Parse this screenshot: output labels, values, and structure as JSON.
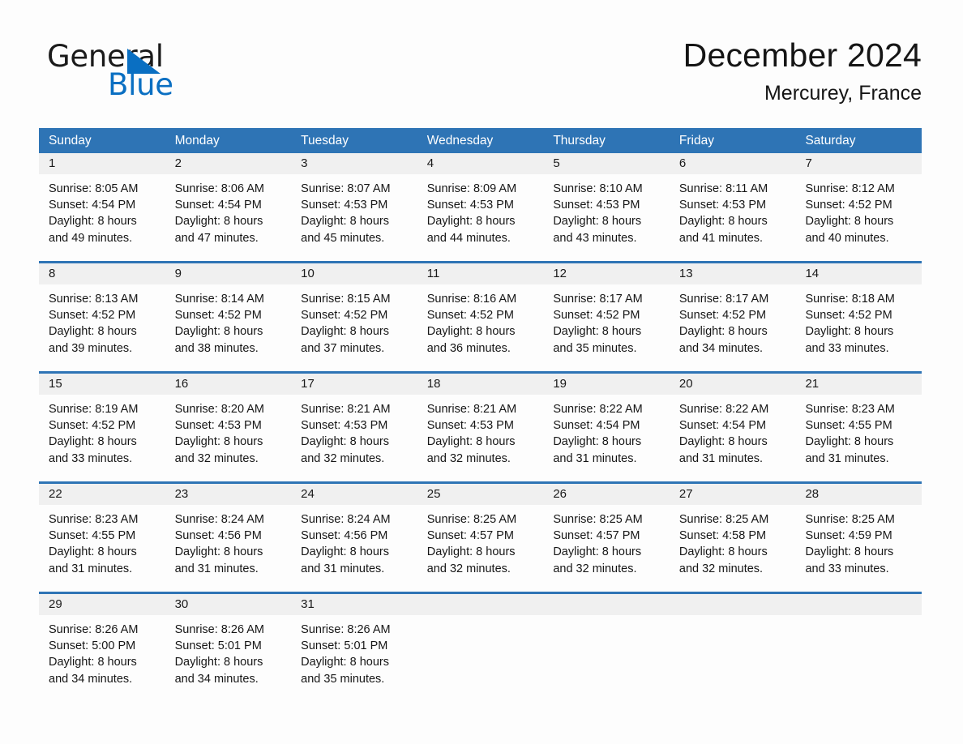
{
  "brand": {
    "name_part1": "General",
    "name_part2": "Blue",
    "logo_icon": "triangle-logo-icon"
  },
  "header": {
    "title": "December 2024",
    "location": "Mercurey, France"
  },
  "calendar": {
    "weekdays": [
      "Sunday",
      "Monday",
      "Tuesday",
      "Wednesday",
      "Thursday",
      "Friday",
      "Saturday"
    ],
    "accent_color": "#2e74b5",
    "day_band_color": "#f0f0f0",
    "weeks": [
      [
        {
          "day": "1",
          "sunrise": "Sunrise: 8:05 AM",
          "sunset": "Sunset: 4:54 PM",
          "daylight_line1": "Daylight: 8 hours",
          "daylight_line2": "and 49 minutes."
        },
        {
          "day": "2",
          "sunrise": "Sunrise: 8:06 AM",
          "sunset": "Sunset: 4:54 PM",
          "daylight_line1": "Daylight: 8 hours",
          "daylight_line2": "and 47 minutes."
        },
        {
          "day": "3",
          "sunrise": "Sunrise: 8:07 AM",
          "sunset": "Sunset: 4:53 PM",
          "daylight_line1": "Daylight: 8 hours",
          "daylight_line2": "and 45 minutes."
        },
        {
          "day": "4",
          "sunrise": "Sunrise: 8:09 AM",
          "sunset": "Sunset: 4:53 PM",
          "daylight_line1": "Daylight: 8 hours",
          "daylight_line2": "and 44 minutes."
        },
        {
          "day": "5",
          "sunrise": "Sunrise: 8:10 AM",
          "sunset": "Sunset: 4:53 PM",
          "daylight_line1": "Daylight: 8 hours",
          "daylight_line2": "and 43 minutes."
        },
        {
          "day": "6",
          "sunrise": "Sunrise: 8:11 AM",
          "sunset": "Sunset: 4:53 PM",
          "daylight_line1": "Daylight: 8 hours",
          "daylight_line2": "and 41 minutes."
        },
        {
          "day": "7",
          "sunrise": "Sunrise: 8:12 AM",
          "sunset": "Sunset: 4:52 PM",
          "daylight_line1": "Daylight: 8 hours",
          "daylight_line2": "and 40 minutes."
        }
      ],
      [
        {
          "day": "8",
          "sunrise": "Sunrise: 8:13 AM",
          "sunset": "Sunset: 4:52 PM",
          "daylight_line1": "Daylight: 8 hours",
          "daylight_line2": "and 39 minutes."
        },
        {
          "day": "9",
          "sunrise": "Sunrise: 8:14 AM",
          "sunset": "Sunset: 4:52 PM",
          "daylight_line1": "Daylight: 8 hours",
          "daylight_line2": "and 38 minutes."
        },
        {
          "day": "10",
          "sunrise": "Sunrise: 8:15 AM",
          "sunset": "Sunset: 4:52 PM",
          "daylight_line1": "Daylight: 8 hours",
          "daylight_line2": "and 37 minutes."
        },
        {
          "day": "11",
          "sunrise": "Sunrise: 8:16 AM",
          "sunset": "Sunset: 4:52 PM",
          "daylight_line1": "Daylight: 8 hours",
          "daylight_line2": "and 36 minutes."
        },
        {
          "day": "12",
          "sunrise": "Sunrise: 8:17 AM",
          "sunset": "Sunset: 4:52 PM",
          "daylight_line1": "Daylight: 8 hours",
          "daylight_line2": "and 35 minutes."
        },
        {
          "day": "13",
          "sunrise": "Sunrise: 8:17 AM",
          "sunset": "Sunset: 4:52 PM",
          "daylight_line1": "Daylight: 8 hours",
          "daylight_line2": "and 34 minutes."
        },
        {
          "day": "14",
          "sunrise": "Sunrise: 8:18 AM",
          "sunset": "Sunset: 4:52 PM",
          "daylight_line1": "Daylight: 8 hours",
          "daylight_line2": "and 33 minutes."
        }
      ],
      [
        {
          "day": "15",
          "sunrise": "Sunrise: 8:19 AM",
          "sunset": "Sunset: 4:52 PM",
          "daylight_line1": "Daylight: 8 hours",
          "daylight_line2": "and 33 minutes."
        },
        {
          "day": "16",
          "sunrise": "Sunrise: 8:20 AM",
          "sunset": "Sunset: 4:53 PM",
          "daylight_line1": "Daylight: 8 hours",
          "daylight_line2": "and 32 minutes."
        },
        {
          "day": "17",
          "sunrise": "Sunrise: 8:21 AM",
          "sunset": "Sunset: 4:53 PM",
          "daylight_line1": "Daylight: 8 hours",
          "daylight_line2": "and 32 minutes."
        },
        {
          "day": "18",
          "sunrise": "Sunrise: 8:21 AM",
          "sunset": "Sunset: 4:53 PM",
          "daylight_line1": "Daylight: 8 hours",
          "daylight_line2": "and 32 minutes."
        },
        {
          "day": "19",
          "sunrise": "Sunrise: 8:22 AM",
          "sunset": "Sunset: 4:54 PM",
          "daylight_line1": "Daylight: 8 hours",
          "daylight_line2": "and 31 minutes."
        },
        {
          "day": "20",
          "sunrise": "Sunrise: 8:22 AM",
          "sunset": "Sunset: 4:54 PM",
          "daylight_line1": "Daylight: 8 hours",
          "daylight_line2": "and 31 minutes."
        },
        {
          "day": "21",
          "sunrise": "Sunrise: 8:23 AM",
          "sunset": "Sunset: 4:55 PM",
          "daylight_line1": "Daylight: 8 hours",
          "daylight_line2": "and 31 minutes."
        }
      ],
      [
        {
          "day": "22",
          "sunrise": "Sunrise: 8:23 AM",
          "sunset": "Sunset: 4:55 PM",
          "daylight_line1": "Daylight: 8 hours",
          "daylight_line2": "and 31 minutes."
        },
        {
          "day": "23",
          "sunrise": "Sunrise: 8:24 AM",
          "sunset": "Sunset: 4:56 PM",
          "daylight_line1": "Daylight: 8 hours",
          "daylight_line2": "and 31 minutes."
        },
        {
          "day": "24",
          "sunrise": "Sunrise: 8:24 AM",
          "sunset": "Sunset: 4:56 PM",
          "daylight_line1": "Daylight: 8 hours",
          "daylight_line2": "and 31 minutes."
        },
        {
          "day": "25",
          "sunrise": "Sunrise: 8:25 AM",
          "sunset": "Sunset: 4:57 PM",
          "daylight_line1": "Daylight: 8 hours",
          "daylight_line2": "and 32 minutes."
        },
        {
          "day": "26",
          "sunrise": "Sunrise: 8:25 AM",
          "sunset": "Sunset: 4:57 PM",
          "daylight_line1": "Daylight: 8 hours",
          "daylight_line2": "and 32 minutes."
        },
        {
          "day": "27",
          "sunrise": "Sunrise: 8:25 AM",
          "sunset": "Sunset: 4:58 PM",
          "daylight_line1": "Daylight: 8 hours",
          "daylight_line2": "and 32 minutes."
        },
        {
          "day": "28",
          "sunrise": "Sunrise: 8:25 AM",
          "sunset": "Sunset: 4:59 PM",
          "daylight_line1": "Daylight: 8 hours",
          "daylight_line2": "and 33 minutes."
        }
      ],
      [
        {
          "day": "29",
          "sunrise": "Sunrise: 8:26 AM",
          "sunset": "Sunset: 5:00 PM",
          "daylight_line1": "Daylight: 8 hours",
          "daylight_line2": "and 34 minutes."
        },
        {
          "day": "30",
          "sunrise": "Sunrise: 8:26 AM",
          "sunset": "Sunset: 5:01 PM",
          "daylight_line1": "Daylight: 8 hours",
          "daylight_line2": "and 34 minutes."
        },
        {
          "day": "31",
          "sunrise": "Sunrise: 8:26 AM",
          "sunset": "Sunset: 5:01 PM",
          "daylight_line1": "Daylight: 8 hours",
          "daylight_line2": "and 35 minutes."
        },
        {
          "day": "",
          "sunrise": "",
          "sunset": "",
          "daylight_line1": "",
          "daylight_line2": ""
        },
        {
          "day": "",
          "sunrise": "",
          "sunset": "",
          "daylight_line1": "",
          "daylight_line2": ""
        },
        {
          "day": "",
          "sunrise": "",
          "sunset": "",
          "daylight_line1": "",
          "daylight_line2": ""
        },
        {
          "day": "",
          "sunrise": "",
          "sunset": "",
          "daylight_line1": "",
          "daylight_line2": ""
        }
      ]
    ]
  }
}
